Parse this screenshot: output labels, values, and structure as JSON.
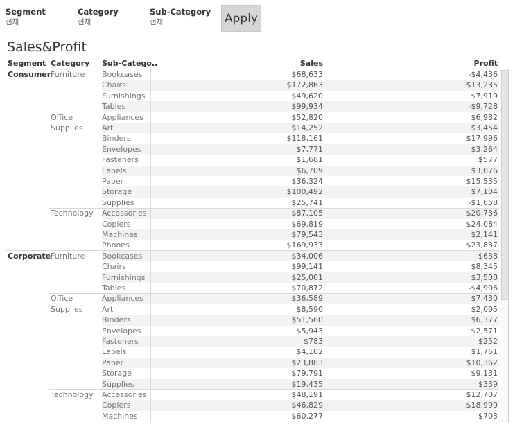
{
  "filters": [
    {
      "label": "Segment",
      "value": "전체"
    },
    {
      "label": "Category",
      "value": "전체"
    },
    {
      "label": "Sub-Category",
      "value": "전체"
    }
  ],
  "apply_label": "Apply",
  "title": "Sales&Profit",
  "columns": {
    "segment": "Segment",
    "category": "Category",
    "subcategory": "Sub-Catego..",
    "sales": "Sales",
    "profit": "Profit"
  },
  "rows": [
    {
      "segment": "Consumer",
      "category": "Furniture",
      "subcategory": "Bookcases",
      "sales": "$68,633",
      "profit": "-$4,436"
    },
    {
      "segment": "Consumer",
      "category": "Furniture",
      "subcategory": "Chairs",
      "sales": "$172,863",
      "profit": "$13,235"
    },
    {
      "segment": "Consumer",
      "category": "Furniture",
      "subcategory": "Furnishings",
      "sales": "$49,620",
      "profit": "$7,919"
    },
    {
      "segment": "Consumer",
      "category": "Furniture",
      "subcategory": "Tables",
      "sales": "$99,934",
      "profit": "-$9,728"
    },
    {
      "segment": "Consumer",
      "category": "Office\nSupplies",
      "subcategory": "Appliances",
      "sales": "$52,820",
      "profit": "$6,982"
    },
    {
      "segment": "Consumer",
      "category": "Office\nSupplies",
      "subcategory": "Art",
      "sales": "$14,252",
      "profit": "$3,454"
    },
    {
      "segment": "Consumer",
      "category": "Office\nSupplies",
      "subcategory": "Binders",
      "sales": "$118,161",
      "profit": "$17,996"
    },
    {
      "segment": "Consumer",
      "category": "Office\nSupplies",
      "subcategory": "Envelopes",
      "sales": "$7,771",
      "profit": "$3,264"
    },
    {
      "segment": "Consumer",
      "category": "Office\nSupplies",
      "subcategory": "Fasteners",
      "sales": "$1,681",
      "profit": "$577"
    },
    {
      "segment": "Consumer",
      "category": "Office\nSupplies",
      "subcategory": "Labels",
      "sales": "$6,709",
      "profit": "$3,076"
    },
    {
      "segment": "Consumer",
      "category": "Office\nSupplies",
      "subcategory": "Paper",
      "sales": "$36,324",
      "profit": "$15,535"
    },
    {
      "segment": "Consumer",
      "category": "Office\nSupplies",
      "subcategory": "Storage",
      "sales": "$100,492",
      "profit": "$7,104"
    },
    {
      "segment": "Consumer",
      "category": "Office\nSupplies",
      "subcategory": "Supplies",
      "sales": "$25,741",
      "profit": "-$1,658"
    },
    {
      "segment": "Consumer",
      "category": "Technology",
      "subcategory": "Accessories",
      "sales": "$87,105",
      "profit": "$20,736"
    },
    {
      "segment": "Consumer",
      "category": "Technology",
      "subcategory": "Copiers",
      "sales": "$69,819",
      "profit": "$24,084"
    },
    {
      "segment": "Consumer",
      "category": "Technology",
      "subcategory": "Machines",
      "sales": "$79,543",
      "profit": "$2,141"
    },
    {
      "segment": "Consumer",
      "category": "Technology",
      "subcategory": "Phones",
      "sales": "$169,933",
      "profit": "$23,837"
    },
    {
      "segment": "Corporate",
      "category": "Furniture",
      "subcategory": "Bookcases",
      "sales": "$34,006",
      "profit": "$638"
    },
    {
      "segment": "Corporate",
      "category": "Furniture",
      "subcategory": "Chairs",
      "sales": "$99,141",
      "profit": "$8,345"
    },
    {
      "segment": "Corporate",
      "category": "Furniture",
      "subcategory": "Furnishings",
      "sales": "$25,001",
      "profit": "$3,508"
    },
    {
      "segment": "Corporate",
      "category": "Furniture",
      "subcategory": "Tables",
      "sales": "$70,872",
      "profit": "-$4,906"
    },
    {
      "segment": "Corporate",
      "category": "Office\nSupplies",
      "subcategory": "Appliances",
      "sales": "$36,589",
      "profit": "$7,430"
    },
    {
      "segment": "Corporate",
      "category": "Office\nSupplies",
      "subcategory": "Art",
      "sales": "$8,590",
      "profit": "$2,005"
    },
    {
      "segment": "Corporate",
      "category": "Office\nSupplies",
      "subcategory": "Binders",
      "sales": "$51,560",
      "profit": "$6,377"
    },
    {
      "segment": "Corporate",
      "category": "Office\nSupplies",
      "subcategory": "Envelopes",
      "sales": "$5,943",
      "profit": "$2,571"
    },
    {
      "segment": "Corporate",
      "category": "Office\nSupplies",
      "subcategory": "Fasteners",
      "sales": "$783",
      "profit": "$252"
    },
    {
      "segment": "Corporate",
      "category": "Office\nSupplies",
      "subcategory": "Labels",
      "sales": "$4,102",
      "profit": "$1,761"
    },
    {
      "segment": "Corporate",
      "category": "Office\nSupplies",
      "subcategory": "Paper",
      "sales": "$23,883",
      "profit": "$10,362"
    },
    {
      "segment": "Corporate",
      "category": "Office\nSupplies",
      "subcategory": "Storage",
      "sales": "$79,791",
      "profit": "$9,131"
    },
    {
      "segment": "Corporate",
      "category": "Office\nSupplies",
      "subcategory": "Supplies",
      "sales": "$19,435",
      "profit": "$339"
    },
    {
      "segment": "Corporate",
      "category": "Technology",
      "subcategory": "Accessories",
      "sales": "$48,191",
      "profit": "$12,707"
    },
    {
      "segment": "Corporate",
      "category": "Technology",
      "subcategory": "Copiers",
      "sales": "$46,829",
      "profit": "$18,990"
    },
    {
      "segment": "Corporate",
      "category": "Technology",
      "subcategory": "Machines",
      "sales": "$60,277",
      "profit": "$703"
    }
  ]
}
